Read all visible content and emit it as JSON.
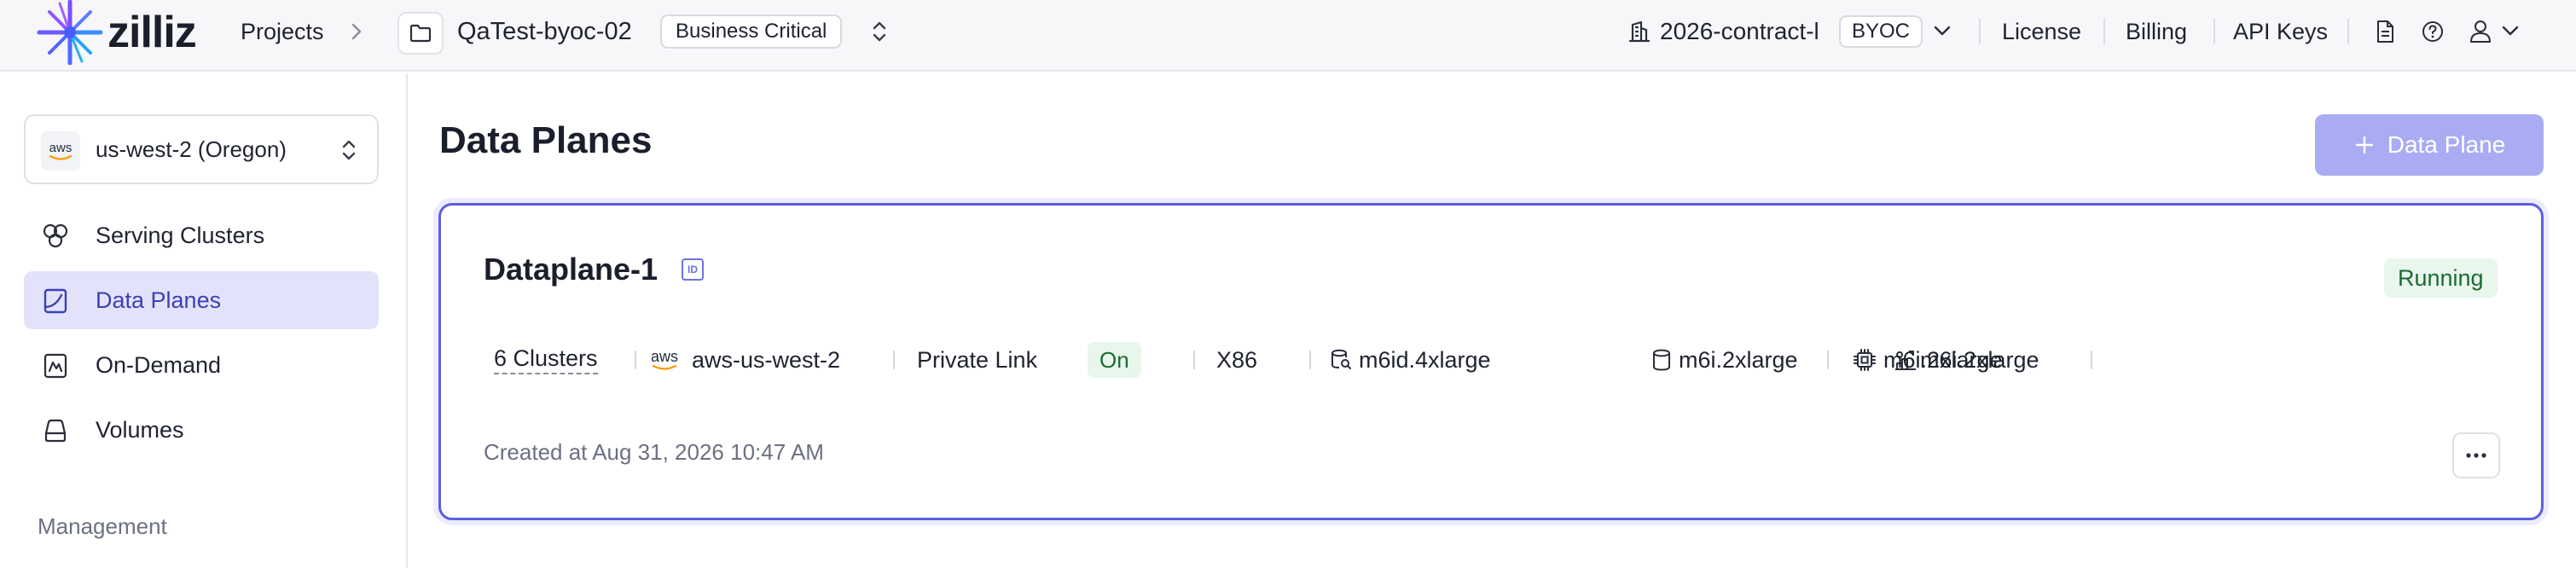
{
  "header": {
    "brand": "zilliz",
    "projects_label": "Projects",
    "project_name": "QaTest-byoc-02",
    "project_tier": "Business Critical",
    "org_name": "2026-contract-l",
    "org_badge": "BYOC",
    "links": [
      "License",
      "Billing",
      "API Keys"
    ]
  },
  "sidebar": {
    "region": {
      "provider_label": "aws",
      "label": "us-west-2 (Oregon)"
    },
    "items": [
      {
        "label": "Serving Clusters",
        "icon": "clusters-icon",
        "active": false
      },
      {
        "label": "Data Planes",
        "icon": "data-plane-icon",
        "active": true
      },
      {
        "label": "On-Demand",
        "icon": "on-demand-icon",
        "active": false
      },
      {
        "label": "Volumes",
        "icon": "volume-icon",
        "active": false
      }
    ],
    "section_label": "Management"
  },
  "main": {
    "title": "Data Planes",
    "add_button_label": "Data Plane",
    "card": {
      "name": "Dataplane-1",
      "id_label": "ID",
      "status": "Running",
      "clusters": "6 Clusters",
      "provider_label": "aws",
      "region": "aws-us-west-2",
      "private_link_label": "Private Link",
      "private_link_status": "On",
      "arch": "X86",
      "instances": [
        {
          "icon": "search-node-icon",
          "type": "m6id.4xlarge"
        },
        {
          "icon": "index-node-icon",
          "type": "m6i.2xlarge"
        },
        {
          "icon": "storage-node-icon",
          "type": "m6i.2xlarge"
        },
        {
          "icon": "cpu-icon",
          "type": "m6i.2xlarge"
        }
      ],
      "created": "Created at Aug 31, 2026 10:47 AM"
    }
  },
  "colors": {
    "accent": "#5b5fe0",
    "accent_light": "#a9acf3",
    "active_nav_bg": "#e2e3fa",
    "running_bg": "#e8f6ec",
    "running_text": "#1d6b33"
  }
}
